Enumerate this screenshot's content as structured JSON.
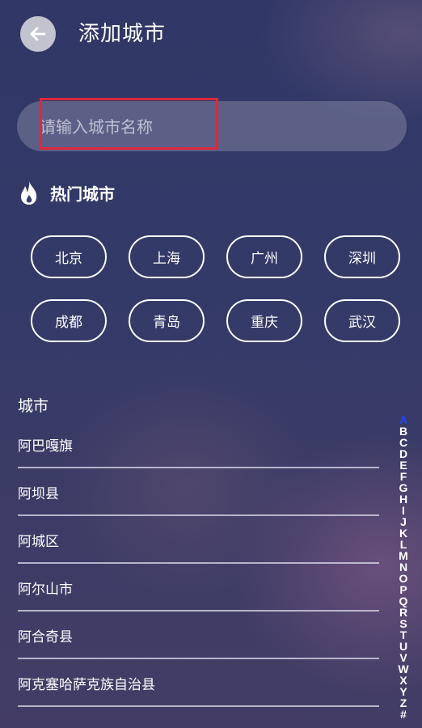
{
  "header": {
    "title": "添加城市",
    "back_icon": "arrow-left-icon"
  },
  "search": {
    "placeholder": "请输入城市名称",
    "value": ""
  },
  "hot": {
    "icon": "flame-icon",
    "title": "热门城市",
    "cities": [
      "北京",
      "上海",
      "广州",
      "深圳",
      "成都",
      "青岛",
      "重庆",
      "武汉"
    ]
  },
  "list": {
    "section_label": "城市",
    "cities": [
      "阿巴嘎旗",
      "阿坝县",
      "阿城区",
      "阿尔山市",
      "阿合奇县",
      "阿克塞哈萨克族自治县"
    ]
  },
  "index": {
    "letters": [
      "A",
      "B",
      "C",
      "D",
      "E",
      "F",
      "G",
      "H",
      "I",
      "J",
      "K",
      "L",
      "M",
      "N",
      "O",
      "P",
      "Q",
      "R",
      "S",
      "T",
      "U",
      "V",
      "W",
      "X",
      "Y",
      "Z",
      "#"
    ],
    "active": "A",
    "active_color": "#2244ee"
  },
  "colors": {
    "highlight": "#e0283b",
    "background": "#343a68"
  }
}
